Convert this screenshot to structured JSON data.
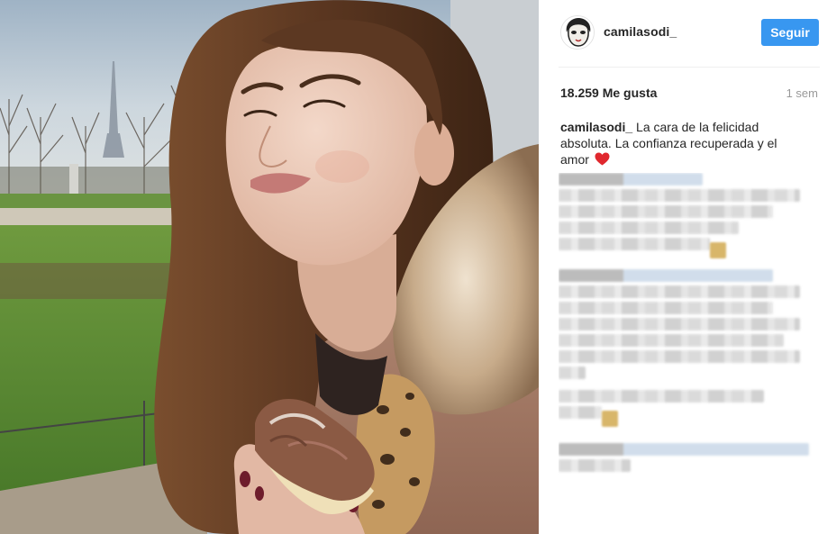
{
  "post": {
    "photo_icon": "photo-post-image",
    "username": "camilasodi_",
    "follow_label": "Seguir",
    "likes_text": "18.259 Me gusta",
    "time_text": "1 sem",
    "caption_user": "camilasodi_",
    "caption_text": "La cara de la felicidad absoluta. La confianza recuperada y el amor",
    "caption_emoji": "heart-icon",
    "comments_state": "blurred"
  },
  "colors": {
    "accent": "#3897f0",
    "heart": "#e0282e",
    "muted": "#999999",
    "text": "#262626"
  }
}
